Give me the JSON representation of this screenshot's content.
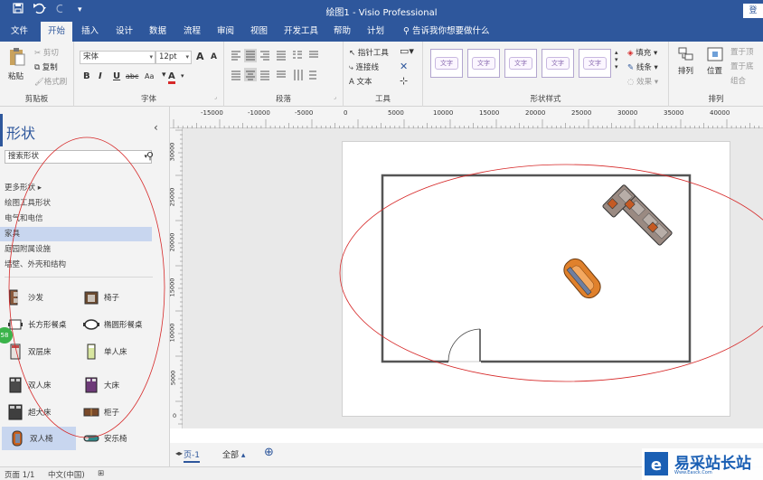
{
  "window": {
    "title": "绘图1 - Visio Professional",
    "sign_in": "登"
  },
  "tabs": [
    "文件",
    "开始",
    "插入",
    "设计",
    "数据",
    "流程",
    "审阅",
    "视图",
    "开发工具",
    "帮助",
    "计划"
  ],
  "active_tab": "开始",
  "tell_me": "告诉我你想要做什么",
  "ribbon": {
    "clipboard": {
      "paste": "粘贴",
      "cut": "剪切",
      "copy": "复制",
      "format_painter": "格式刷",
      "label": "剪贴板"
    },
    "font": {
      "family": "宋体",
      "size": "12pt",
      "label": "字体",
      "grow": "A",
      "shrink": "A",
      "bold": "B",
      "italic": "I",
      "underline": "U",
      "strike": "abc",
      "case": "Aa",
      "color": "A"
    },
    "paragraph": {
      "label": "段落"
    },
    "tools": {
      "pointer": "指针工具",
      "connector": "连接线",
      "text": "文本",
      "label": "工具"
    },
    "shape_styles": {
      "label": "形状样式",
      "samples": [
        "文字",
        "文字",
        "文字",
        "文字",
        "文字"
      ],
      "fill": "填充",
      "line": "线条",
      "effects": "效果"
    },
    "arrange": {
      "arrange": "排列",
      "position": "位置",
      "bring_front": "置于顶",
      "send_back": "置于底",
      "group": "组合",
      "label": "排列"
    }
  },
  "shapes_pane": {
    "title": "形状",
    "search_placeholder": "搜索形状",
    "more_shapes": "更多形状",
    "stencils": [
      "绘图工具形状",
      "电气和电信",
      "家具",
      "庭园附属设施",
      "墙壁、外壳和结构"
    ],
    "selected_stencil": "家具",
    "items": [
      {
        "label": "沙发"
      },
      {
        "label": "椅子"
      },
      {
        "label": "长方形餐桌"
      },
      {
        "label": "椭圆形餐桌"
      },
      {
        "label": "双层床"
      },
      {
        "label": "单人床"
      },
      {
        "label": "双人床"
      },
      {
        "label": "大床"
      },
      {
        "label": "超大床"
      },
      {
        "label": "柜子"
      },
      {
        "label": "双人椅"
      },
      {
        "label": "安乐椅"
      }
    ],
    "selected_item": "双人椅",
    "badge": "58"
  },
  "ruler": {
    "h_labels": [
      "-15000",
      "-10000",
      "-5000",
      "0",
      "5000",
      "10000",
      "15000",
      "20000",
      "25000",
      "30000",
      "35000",
      "40000"
    ],
    "v_labels": [
      "30000",
      "25000",
      "20000",
      "15000",
      "10000",
      "5000",
      "0"
    ]
  },
  "page_tabs": {
    "page": "页-1",
    "all": "全部"
  },
  "status": {
    "page": "页面 1/1",
    "language": "中文(中国)"
  },
  "watermark": {
    "text": "易采站长站",
    "sub": "Www.Easck.Com"
  },
  "colors": {
    "accent": "#2e579c",
    "annotation": "#d62828",
    "sofa": "#c45a24",
    "loveseat": "#e0812c"
  }
}
